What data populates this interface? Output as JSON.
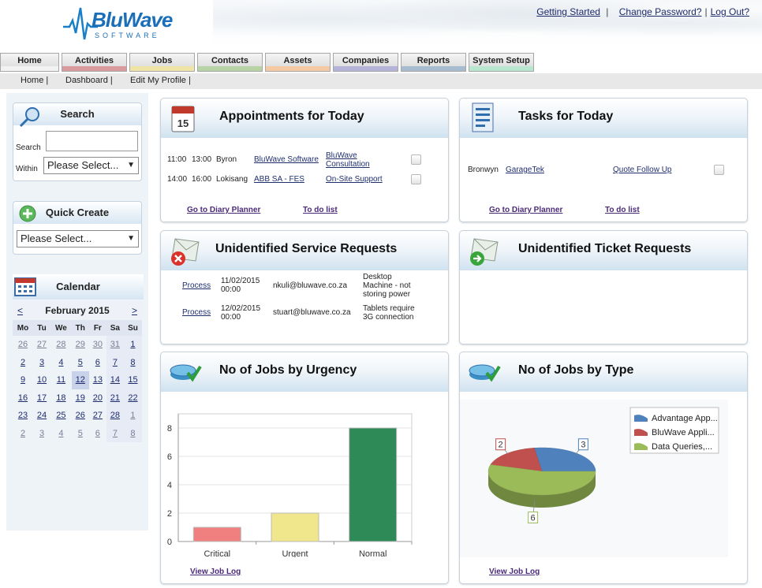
{
  "header": {
    "logo_main": "BluWave",
    "logo_sub": "SOFTWARE",
    "links": {
      "getting_started": "Getting Started",
      "change_password": "Change Password?",
      "logout": "Log Out?"
    }
  },
  "tabs": [
    {
      "label": "Home",
      "color": "#f2f2f2"
    },
    {
      "label": "Activities",
      "color": "#d99a9e"
    },
    {
      "label": "Jobs",
      "color": "#efe5a6"
    },
    {
      "label": "Contacts",
      "color": "#b8d3a5"
    },
    {
      "label": "Assets",
      "color": "#f5c9a3"
    },
    {
      "label": "Companies",
      "color": "#b5b3d8"
    },
    {
      "label": "Reports",
      "color": "#a8bcd0"
    },
    {
      "label": "System Setup",
      "color": "#b8e6cf"
    }
  ],
  "subnav": {
    "home": "Home |",
    "dashboard": "Dashboard |",
    "profile": "Edit My Profile |"
  },
  "search": {
    "title": "Search",
    "search_label": "Search",
    "within_label": "Within",
    "within_value": "Please Select...",
    "input_value": ""
  },
  "quick_create": {
    "title": "Quick Create",
    "value": "Please Select..."
  },
  "calendar": {
    "title": "Calendar",
    "prev": "<",
    "next": ">",
    "month": "February 2015",
    "days": [
      "Mo",
      "Tu",
      "We",
      "Th",
      "Fr",
      "Sa",
      "Su"
    ],
    "weeks": [
      [
        "26",
        "27",
        "28",
        "29",
        "30",
        "31",
        "1"
      ],
      [
        "2",
        "3",
        "4",
        "5",
        "6",
        "7",
        "8"
      ],
      [
        "9",
        "10",
        "11",
        "12",
        "13",
        "14",
        "15"
      ],
      [
        "16",
        "17",
        "18",
        "19",
        "20",
        "21",
        "22"
      ],
      [
        "23",
        "24",
        "25",
        "26",
        "27",
        "28",
        "1"
      ],
      [
        "2",
        "3",
        "4",
        "5",
        "6",
        "7",
        "8"
      ]
    ]
  },
  "appointments": {
    "title": "Appointments for Today",
    "rows": [
      {
        "start": "11:00",
        "end": "13:00",
        "person": "Byron",
        "company": "BluWave Software",
        "type1": "BluWave",
        "type2": "Consultation"
      },
      {
        "start": "14:00",
        "end": "16:00",
        "person": "Lokisang",
        "company": "ABB SA - FES",
        "type1": "On-Site Support",
        "type2": ""
      }
    ],
    "link_diary": "Go to Diary Planner",
    "link_todo": "To do list"
  },
  "tasks": {
    "title": "Tasks for Today",
    "rows": [
      {
        "person": "Bronwyn",
        "company": "GarageTek",
        "task": "Quote Follow Up"
      }
    ],
    "link_diary": "Go to Diary Planner",
    "link_todo": "To do list"
  },
  "service_requests": {
    "title": "Unidentified Service Requests",
    "rows": [
      {
        "action": "Process",
        "date": "11/02/2015",
        "time": "00:00",
        "email": "nkuli@bluwave.co.za",
        "desc1": "Desktop",
        "desc2": "Machine - not",
        "desc3": "storing power"
      },
      {
        "action": "Process",
        "date": "12/02/2015",
        "time": "00:00",
        "email": "stuart@bluwave.co.za",
        "desc1": "Tablets require",
        "desc2": "3G connection",
        "desc3": ""
      }
    ]
  },
  "ticket_requests": {
    "title": "Unidentified Ticket Requests"
  },
  "jobs_urgency": {
    "title": "No of Jobs by Urgency",
    "link": "View Job Log"
  },
  "jobs_type": {
    "title": "No of Jobs by Type",
    "link": "View Job Log"
  },
  "chart_data": [
    {
      "type": "bar",
      "categories": [
        "Critical",
        "Urgent",
        "Normal"
      ],
      "values": [
        1,
        2,
        8
      ],
      "colors": [
        "#f08080",
        "#f0e68c",
        "#2e8b57"
      ],
      "ylim": [
        0,
        9
      ],
      "yticks": [
        "0",
        "2",
        "4",
        "6",
        "8"
      ],
      "grid": true
    },
    {
      "type": "pie",
      "categories": [
        "Advantage App...",
        "BluWave Appli...",
        "Data Queries,..."
      ],
      "values": [
        3,
        2,
        6
      ],
      "value_labels": [
        "3",
        "2",
        "6"
      ],
      "colors": [
        "#4f81bd",
        "#c0504d",
        "#9bbb59"
      ],
      "legend": "top-right"
    }
  ]
}
